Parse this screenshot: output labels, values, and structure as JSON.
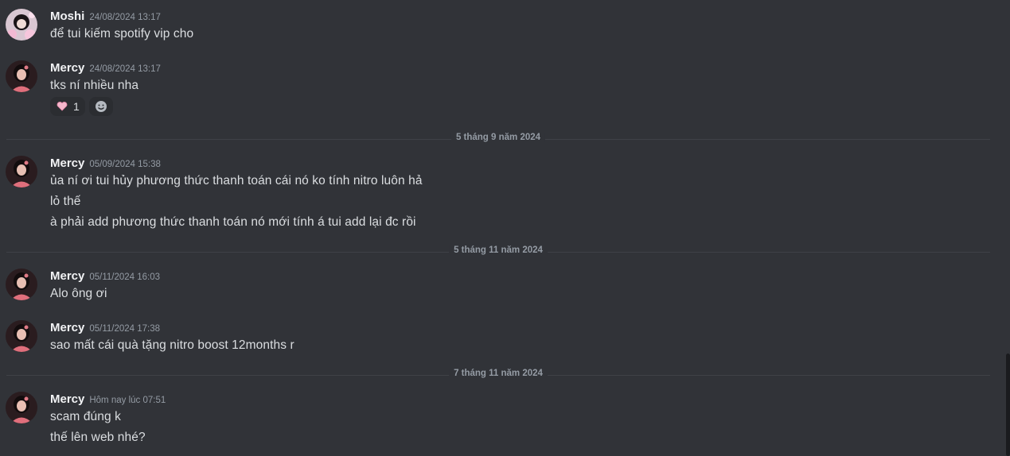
{
  "messages": [
    {
      "author": "Moshi",
      "time": "24/08/2024 13:17",
      "lines": [
        "để tui kiếm spotify vip cho"
      ]
    },
    {
      "author": "Mercy",
      "time": "24/08/2024 13:17",
      "lines": [
        "tks ní nhiều nha"
      ],
      "reactions": [
        {
          "icon": "heart-emoji",
          "count": "1"
        },
        {
          "icon": "add-reaction-icon"
        }
      ]
    },
    {
      "author": "Mercy",
      "time": "05/09/2024 15:38",
      "lines": [
        "ủa ní ơi tui hủy phương thức thanh toán cái nó ko tính nitro luôn hả",
        "lỏ thế",
        "à phải add phương thức thanh toán nó mới tính á tui add lại đc rồi"
      ]
    },
    {
      "author": "Mercy",
      "time": "05/11/2024 16:03",
      "lines": [
        "Alo ông ơi"
      ]
    },
    {
      "author": "Mercy",
      "time": "05/11/2024 17:38",
      "lines": [
        "sao mất cái quà tặng nitro boost 12months r"
      ]
    },
    {
      "author": "Mercy",
      "time": "Hôm nay lúc 07:51",
      "lines": [
        "scam đúng k",
        "thế lên web nhé?"
      ]
    }
  ],
  "dividers": [
    "5 tháng 9 năm 2024",
    "5 tháng 11 năm 2024",
    "7 tháng 11 năm 2024"
  ],
  "colors": {
    "background": "#313338",
    "username": "#f2f3f5",
    "text": "#dbdee1",
    "muted": "#949ba4",
    "reaction_bg": "#2b2d31"
  }
}
